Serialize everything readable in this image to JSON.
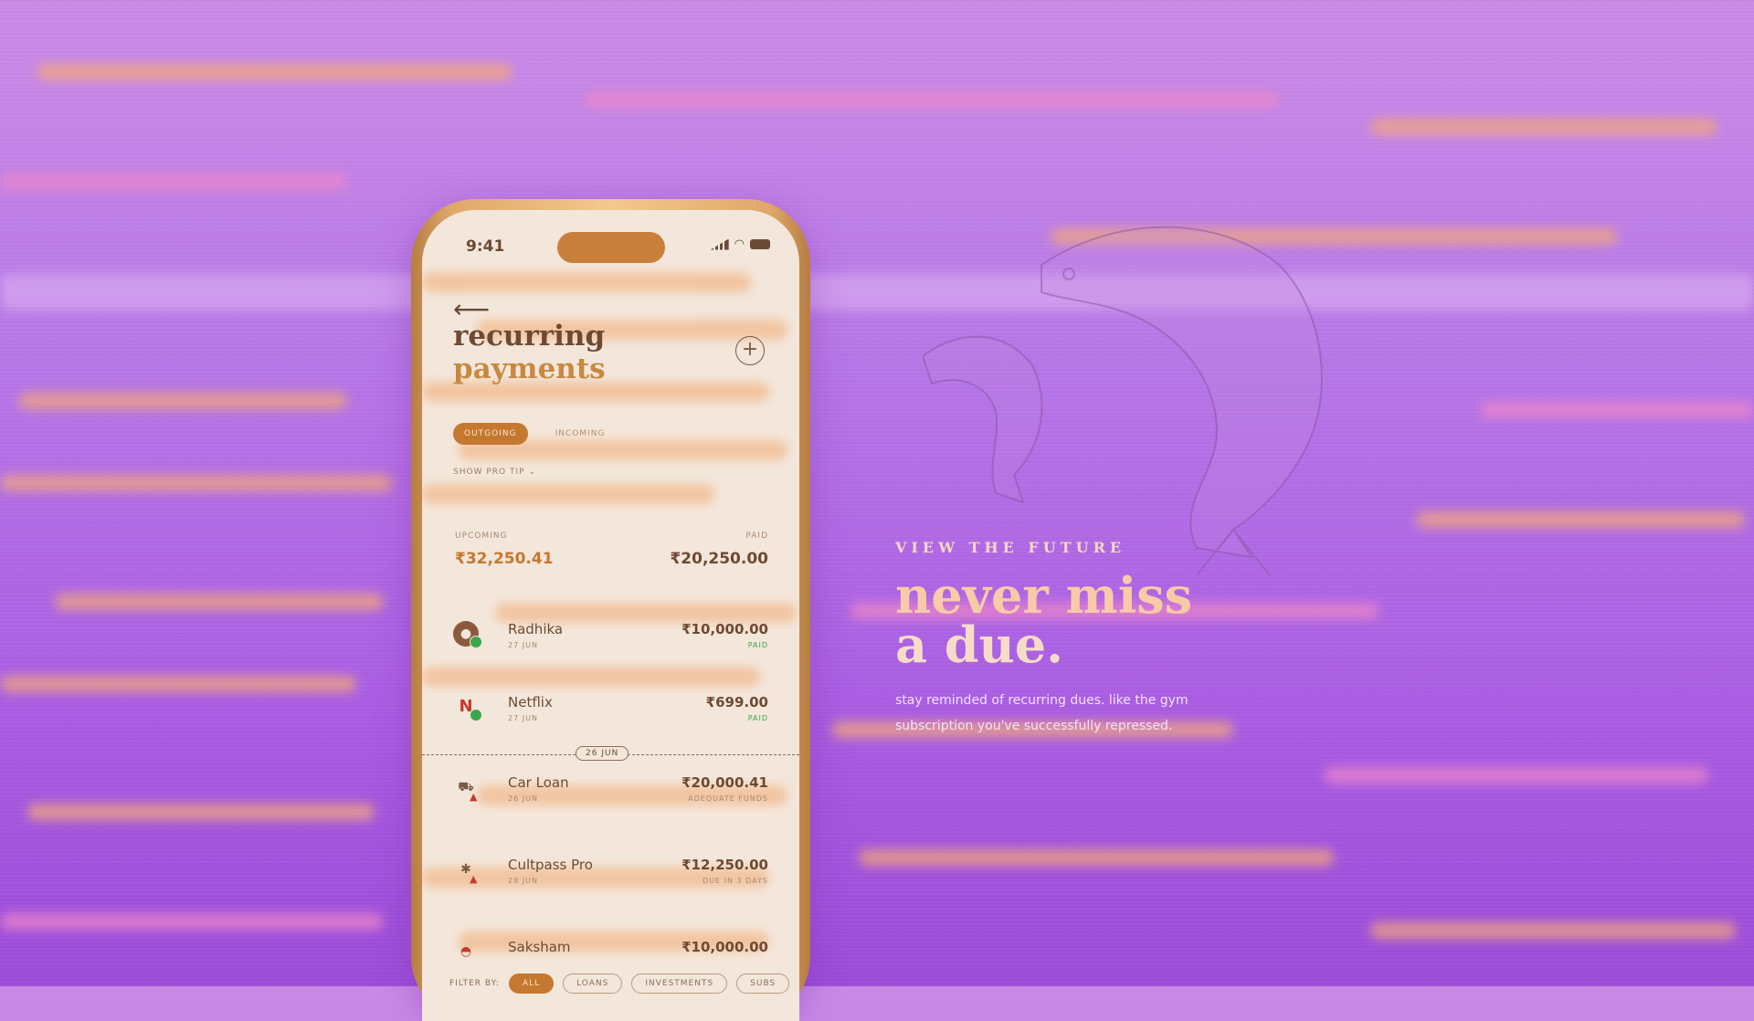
{
  "colors": {
    "background_top": "#c98ae6",
    "background_bottom": "#9b4bd8",
    "accent": "#c5782f",
    "paid_green": "#3aa64e",
    "screen_bg": "#f3e6da"
  },
  "phone": {
    "status_bar": {
      "time": "9:41",
      "icons": [
        "signal-icon",
        "wifi-icon",
        "battery-icon"
      ]
    },
    "back_icon": "arrow-left-icon",
    "title_line1": "recurring",
    "title_line2": "payments",
    "add_icon": "plus-icon",
    "tabs": [
      {
        "label": "OUTGOING",
        "active": true
      },
      {
        "label": "INCOMING",
        "active": false
      }
    ],
    "pro_tip": "SHOW PRO TIP ⌄",
    "summary": {
      "upcoming_label": "UPCOMING",
      "paid_label": "PAID",
      "upcoming_value": "₹32,250.41",
      "paid_value": "₹20,250.00"
    },
    "payments": [
      {
        "name": "Radhika",
        "date": "27 JUN",
        "amount": "₹10,000.00",
        "status": "PAID",
        "icon": "avatar-icon"
      },
      {
        "name": "Netflix",
        "date": "27 JUN",
        "amount": "₹699.00",
        "status": "PAID",
        "icon": "netflix-icon"
      },
      {
        "name": "Car Loan",
        "date": "26 JUN",
        "amount": "₹20,000.41",
        "status": "ADEQUATE FUNDS",
        "icon": "car-icon"
      },
      {
        "name": "Cultpass Pro",
        "date": "28 JUN",
        "amount": "₹12,250.00",
        "status": "DUE IN 3 DAYS",
        "icon": "fitness-icon"
      },
      {
        "name": "Saksham",
        "date": "",
        "amount": "₹10,000.00",
        "status": "",
        "icon": "avatar-icon"
      }
    ],
    "date_divider": "26 JUN",
    "filter": {
      "label": "FILTER BY:",
      "chips": [
        {
          "label": "ALL",
          "active": true
        },
        {
          "label": "LOANS"
        },
        {
          "label": "INVESTMENTS"
        },
        {
          "label": "SUBS"
        }
      ]
    }
  },
  "hero": {
    "eyebrow": "VIEW THE FUTURE",
    "headline_line1": "never miss",
    "headline_line2": "a due.",
    "subtitle_line1": "stay reminded of recurring dues. like the gym",
    "subtitle_line2": "subscription you've successfully repressed."
  },
  "decor": {
    "illustration": "leaping-fish-icon"
  }
}
